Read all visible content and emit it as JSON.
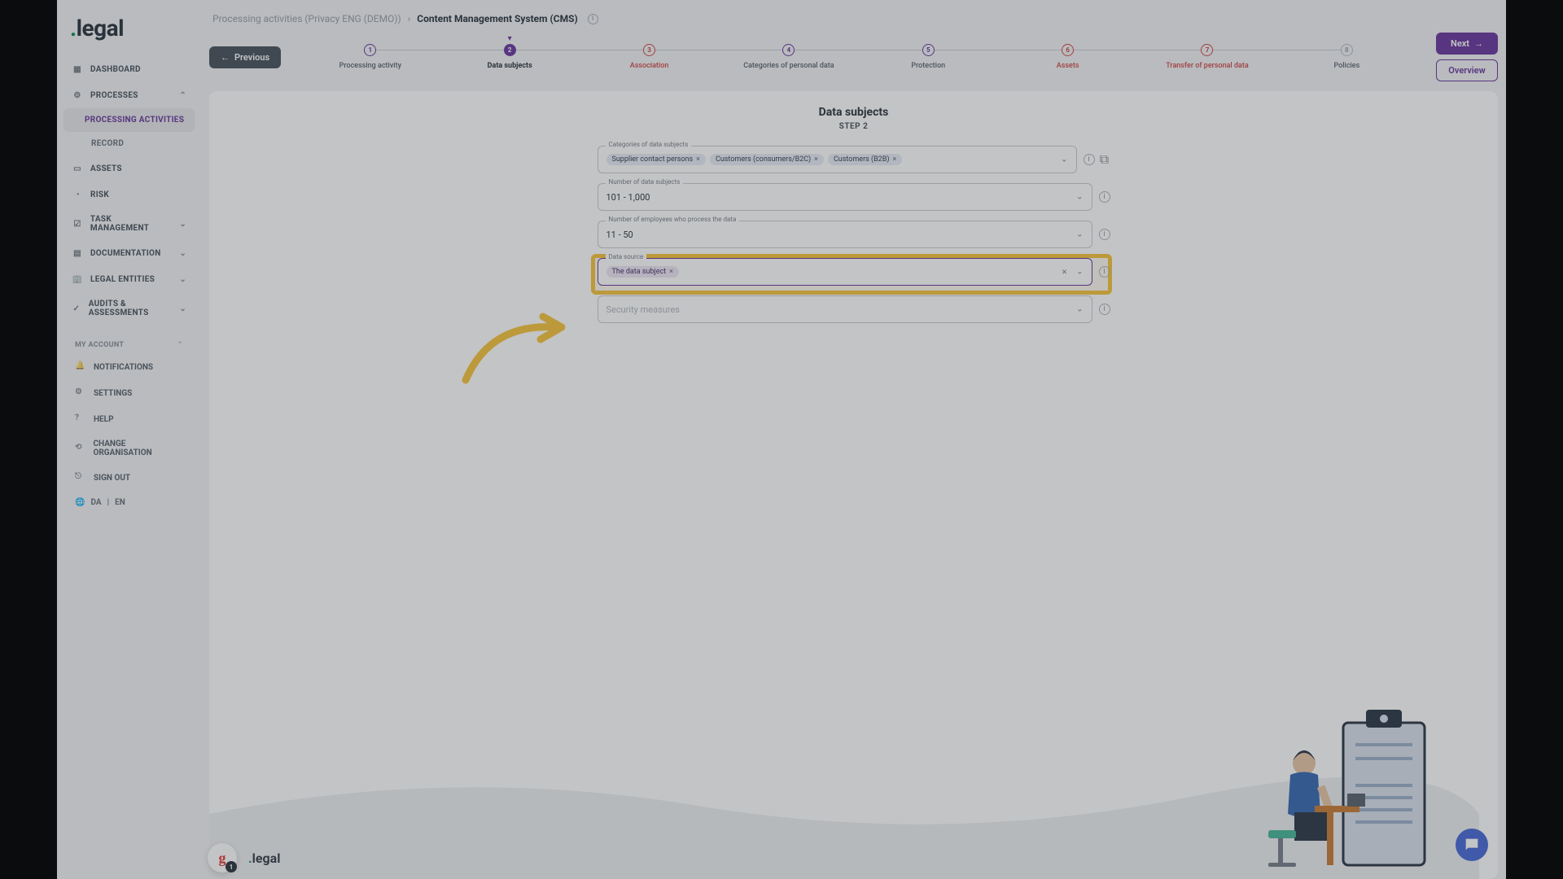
{
  "logo": {
    "brand": "legal"
  },
  "sidebar": {
    "dashboard": "DASHBOARD",
    "processes": "PROCESSES",
    "processing_activities": "PROCESSING ACTIVITIES",
    "record": "RECORD",
    "assets": "ASSETS",
    "risk": "RISK",
    "task_management": "TASK MANAGEMENT",
    "documentation": "DOCUMENTATION",
    "legal_entities": "LEGAL ENTITIES",
    "audits": "AUDITS & ASSESSMENTS"
  },
  "account": {
    "header": "MY ACCOUNT",
    "notifications": "NOTIFICATIONS",
    "settings": "SETTINGS",
    "help": "HELP",
    "change_org": "CHANGE ORGANISATION",
    "sign_out": "SIGN OUT",
    "lang_da": "DA",
    "lang_sep": "|",
    "lang_en": "EN"
  },
  "breadcrumb": {
    "parent": "Processing activities (Privacy ENG (DEMO))",
    "current": "Content Management System (CMS)"
  },
  "nav_buttons": {
    "previous": "Previous",
    "next": "Next",
    "overview": "Overview"
  },
  "steps": [
    {
      "num": "1",
      "label": "Processing activity",
      "state": "done"
    },
    {
      "num": "2",
      "label": "Data subjects",
      "state": "current"
    },
    {
      "num": "3",
      "label": "Association",
      "state": "err"
    },
    {
      "num": "4",
      "label": "Categories of personal data",
      "state": "done"
    },
    {
      "num": "5",
      "label": "Protection",
      "state": "done"
    },
    {
      "num": "6",
      "label": "Assets",
      "state": "err"
    },
    {
      "num": "7",
      "label": "Transfer of personal data",
      "state": "err"
    },
    {
      "num": "8",
      "label": "Policies",
      "state": "todo"
    }
  ],
  "form": {
    "title": "Data subjects",
    "subtitle": "STEP 2",
    "categories": {
      "label": "Categories of data subjects",
      "chips": [
        "Supplier contact persons",
        "Customers (consumers/B2C)",
        "Customers (B2B)"
      ]
    },
    "num_subjects": {
      "label": "Number of data subjects",
      "value": "101 - 1,000"
    },
    "num_employees": {
      "label": "Number of employees who process the data",
      "value": "11 - 50"
    },
    "data_source": {
      "label": "Data source",
      "chip": "The data subject",
      "input": ""
    },
    "security": {
      "label": "Security measures",
      "placeholder": "Security measures"
    }
  },
  "footer": {
    "badge_letter": "g",
    "badge_count": "1",
    "brand": "legal"
  }
}
